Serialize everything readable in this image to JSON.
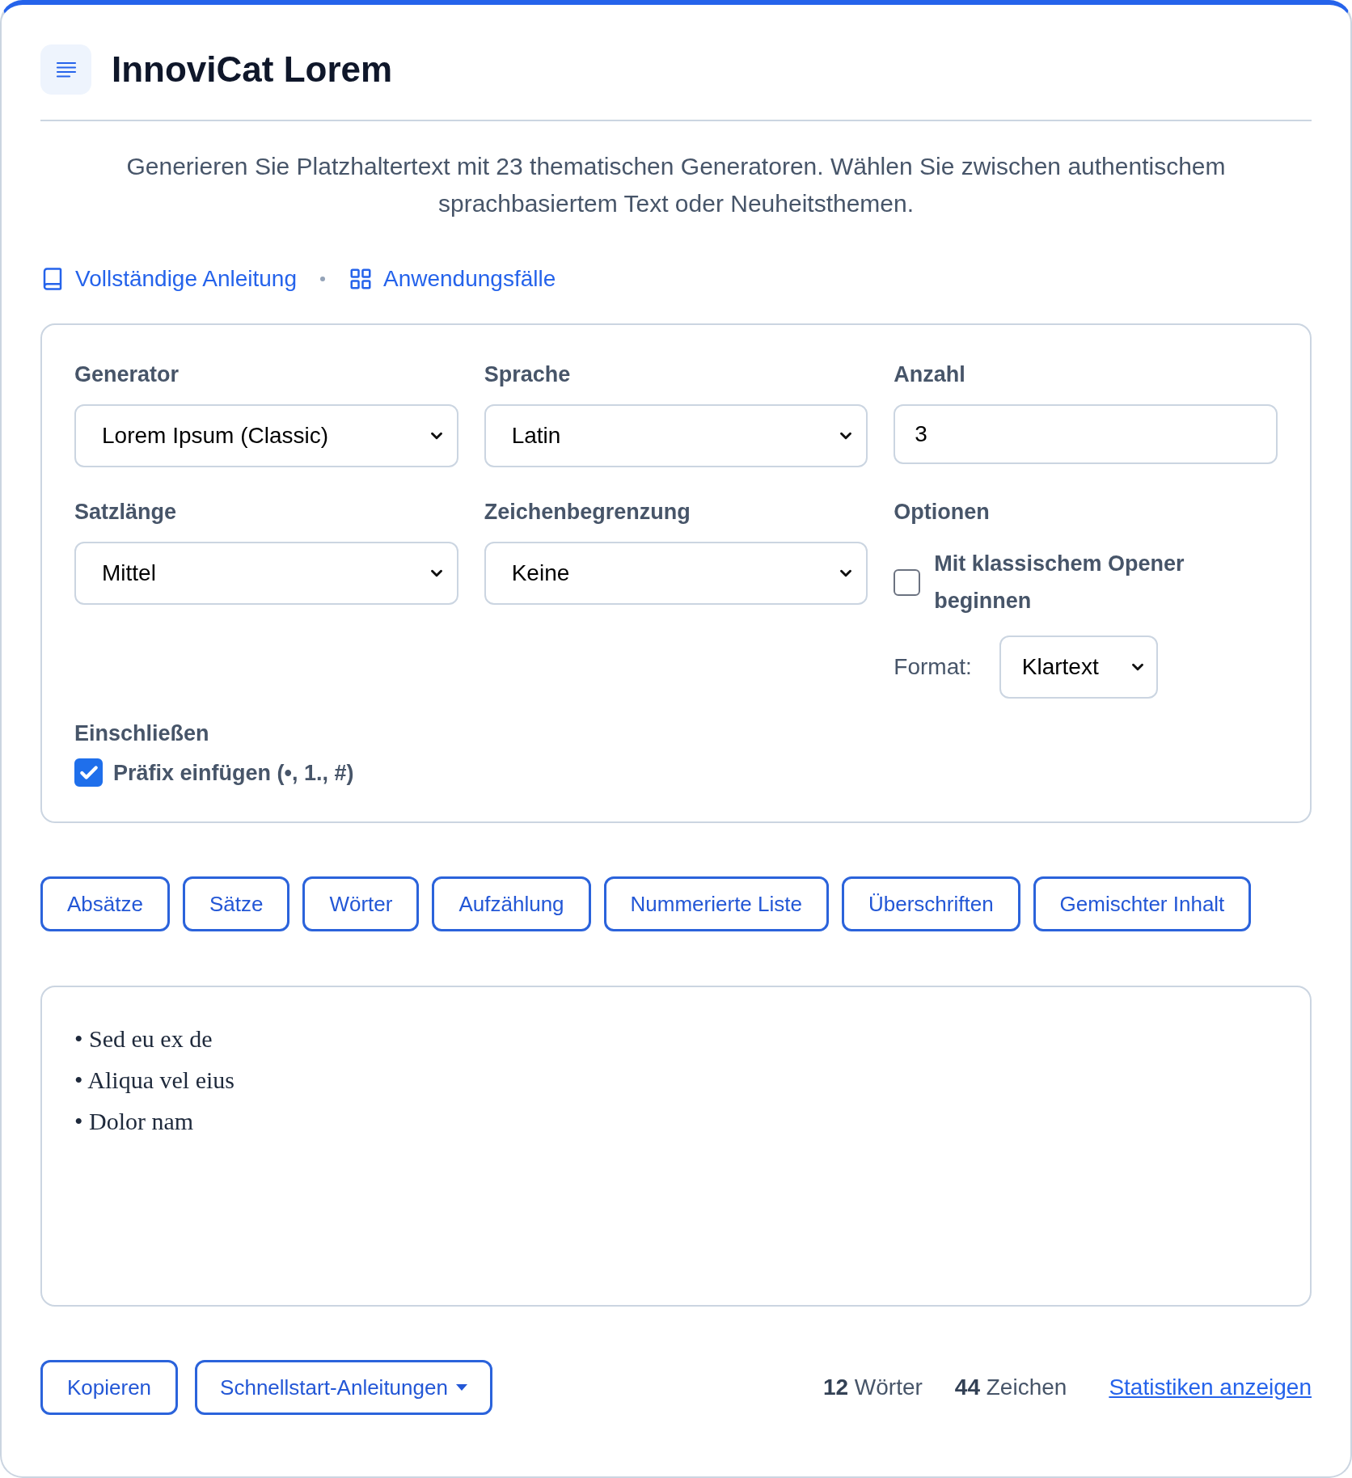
{
  "header": {
    "title": "InnoviCat Lorem"
  },
  "description": "Generieren Sie Platzhaltertext mit 23 thematischen Generatoren. Wählen Sie zwischen authentischem sprachbasiertem Text oder Neuheitsthemen.",
  "links": [
    {
      "kind": "book",
      "label": "Vollständige Anleitung"
    },
    {
      "kind": "grid",
      "label": "Anwendungsfälle"
    }
  ],
  "settings": {
    "fields": [
      {
        "kind": "select",
        "label": "Generator",
        "value": "Lorem Ipsum (Classic)"
      },
      {
        "kind": "select",
        "label": "Sprache",
        "value": "Latin"
      },
      {
        "kind": "input",
        "label": "Anzahl",
        "value": "3"
      },
      {
        "kind": "select",
        "label": "Satzlänge",
        "value": "Mittel"
      },
      {
        "kind": "select",
        "label": "Zeichenbegrenzung",
        "value": "Keine"
      }
    ],
    "options": {
      "label": "Optionen",
      "checkbox": {
        "label": "Mit klassischem Opener beginnen",
        "checked": false
      },
      "format": {
        "label": "Format:",
        "value": "Klartext"
      }
    },
    "include": {
      "label": "Einschließen",
      "checkbox": {
        "label": "Präfix einfügen (•, 1., #)",
        "checked": true
      }
    }
  },
  "format_buttons": [
    "Absätze",
    "Sätze",
    "Wörter",
    "Aufzählung",
    "Nummerierte Liste",
    "Überschriften",
    "Gemischter Inhalt"
  ],
  "output": {
    "lines": [
      "• Sed eu ex de",
      "• Aliqua vel eius",
      "• Dolor nam"
    ]
  },
  "footer": {
    "buttons": [
      {
        "kind": "button",
        "label": "Kopieren"
      },
      {
        "kind": "dropdown",
        "label": "Schnellstart-Anleitungen"
      }
    ],
    "stats": [
      "**12** Wörter",
      "**44** Zeichen"
    ],
    "link": "Statistiken anzeigen"
  }
}
